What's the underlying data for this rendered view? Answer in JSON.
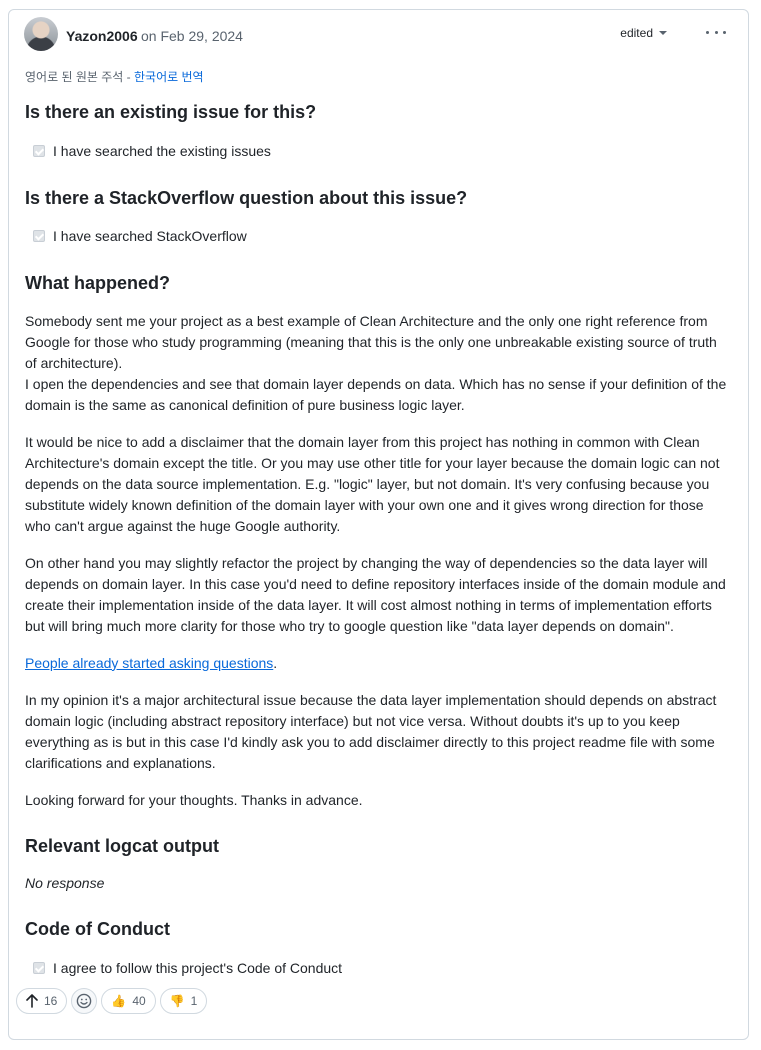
{
  "comment": {
    "author": "Yazon2006",
    "date": "on Feb 29, 2024",
    "edited_label": "edited",
    "translate_prefix": "영어로 된 원본 주석 - ",
    "translate_link": "한국어로 번역"
  },
  "sections": {
    "existing_issue": {
      "heading": "Is there an existing issue for this?",
      "checkbox_label": "I have searched the existing issues"
    },
    "stackoverflow": {
      "heading": "Is there a StackOverflow question about this issue?",
      "checkbox_label": "I have searched StackOverflow"
    },
    "what_happened": {
      "heading": "What happened?",
      "p1a": "Somebody sent me your project as a best example of Clean Architecture and the only one right reference from Google for those who study programming (meaning that this is the only one unbreakable existing source of truth of architecture).",
      "p1b": "I open the dependencies and see that domain layer depends on data. Which has no sense if your definition of the domain is the same as canonical definition of pure business logic layer.",
      "p2": "It would be nice to add a disclaimer that the domain layer from this project has nothing in common with Clean Architecture's domain except the title. Or you may use other title for your layer because the domain logic can not depends on the data source implementation. E.g. \"logic\" layer, but not domain. It's very confusing because you substitute widely known definition of the domain layer with your own one and it gives wrong direction for those who can't argue against the huge Google authority.",
      "p3": "On other hand you may slightly refactor the project by changing the way of dependencies so the data layer will depends on domain layer. In this case you'd need to define repository interfaces inside of the domain module and create their implementation inside of the data layer. It will cost almost nothing in terms of implementation efforts but will bring much more clarity for those who try to google question like \"data layer depends on domain\".",
      "link_text": "People already started asking questions",
      "link_suffix": ".",
      "p5": "In my opinion it's a major architectural issue because the data layer implementation should depends on abstract domain logic (including abstract repository interface) but not vice versa. Without doubts it's up to you keep everything as is but in this case I'd kindly ask you to add disclaimer directly to this project readme file with some clarifications and explanations.",
      "p6": "Looking forward for your thoughts. Thanks in advance."
    },
    "logcat": {
      "heading": "Relevant logcat output",
      "value": "No response"
    },
    "conduct": {
      "heading": "Code of Conduct",
      "checkbox_label": "I agree to follow this project's Code of Conduct"
    }
  },
  "reactions": {
    "upvote_count": "16",
    "thumbs_up_emoji": "👍",
    "thumbs_up_count": "40",
    "thumbs_down_emoji": "👎",
    "thumbs_down_count": "1"
  }
}
